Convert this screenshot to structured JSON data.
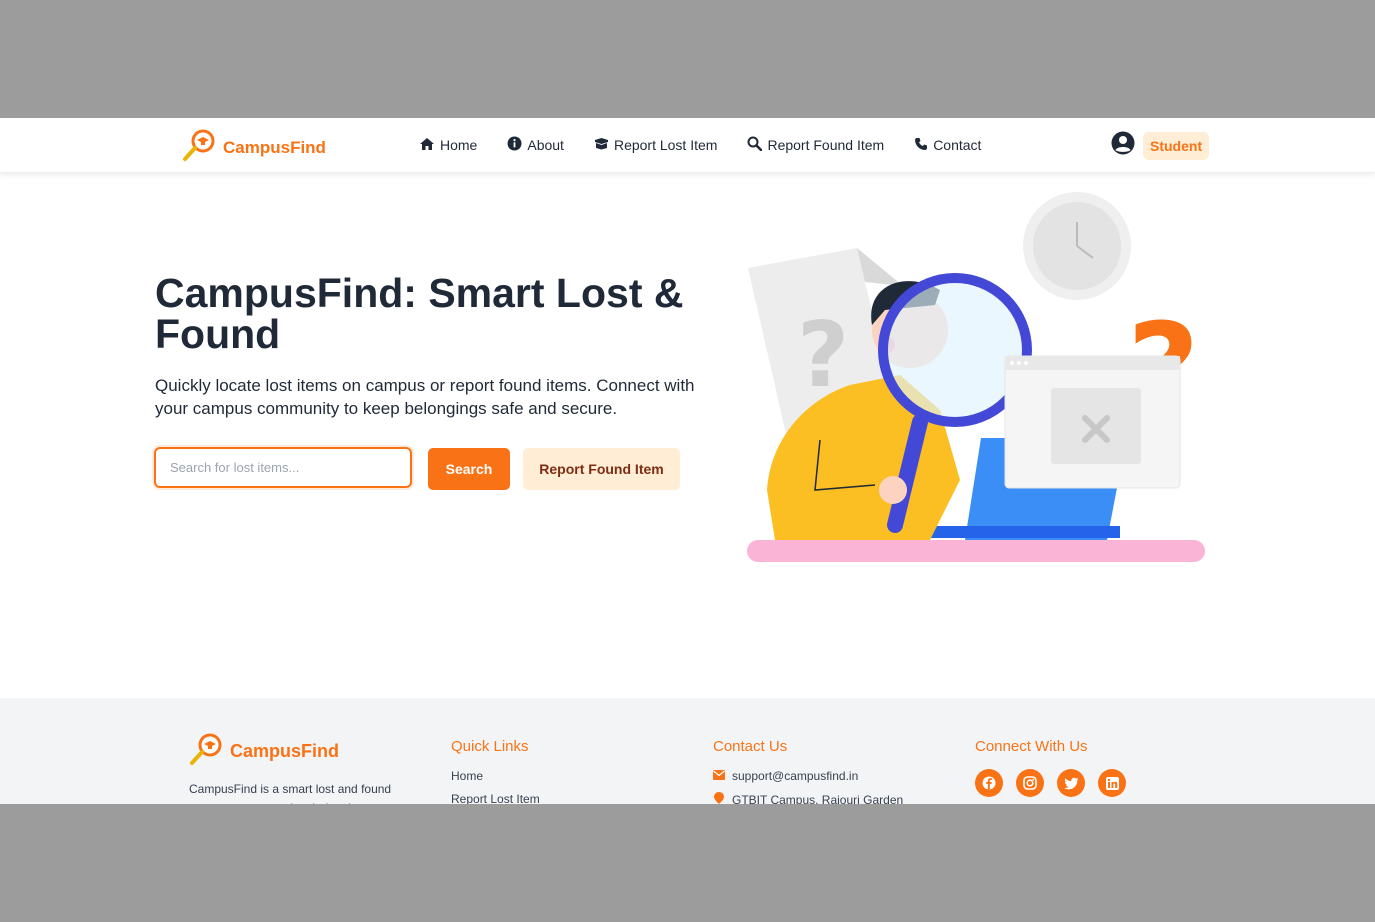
{
  "app": {
    "name": "CampusFind"
  },
  "nav": {
    "items": [
      {
        "label": "Home",
        "icon": "home-icon"
      },
      {
        "label": "About",
        "icon": "info-icon"
      },
      {
        "label": "Report Lost Item",
        "icon": "box-icon"
      },
      {
        "label": "Report Found Item",
        "icon": "search-icon"
      },
      {
        "label": "Contact",
        "icon": "phone-icon"
      }
    ],
    "user_icon": "user-circle-icon",
    "role": "Student"
  },
  "hero": {
    "title": "CampusFind: Smart Lost & Found",
    "subtitle": "Quickly locate lost items on campus or report found items. Connect with your campus community to keep belongings safe and secure.",
    "search_placeholder": "Search for lost items...",
    "search_button": "Search",
    "report_button": "Report Found Item"
  },
  "footer": {
    "brand": "CampusFind",
    "description": "CampusFind is a smart lost and found system to manage lost belongings.",
    "quick_links": {
      "heading": "Quick Links",
      "items": [
        "Home",
        "Report Lost Item"
      ]
    },
    "contact": {
      "heading": "Contact Us",
      "email": "support@campusfind.in",
      "address": "GTBIT Campus, Rajouri Garden"
    },
    "social": {
      "heading": "Connect With Us",
      "icons": [
        "facebook-icon",
        "instagram-icon",
        "twitter-icon",
        "linkedin-icon"
      ]
    }
  },
  "colors": {
    "accent": "#f97316",
    "accent_light": "#ffedd5",
    "text": "#1f2937",
    "backdrop": "#9c9c9c",
    "footer_bg": "#f3f4f6"
  }
}
